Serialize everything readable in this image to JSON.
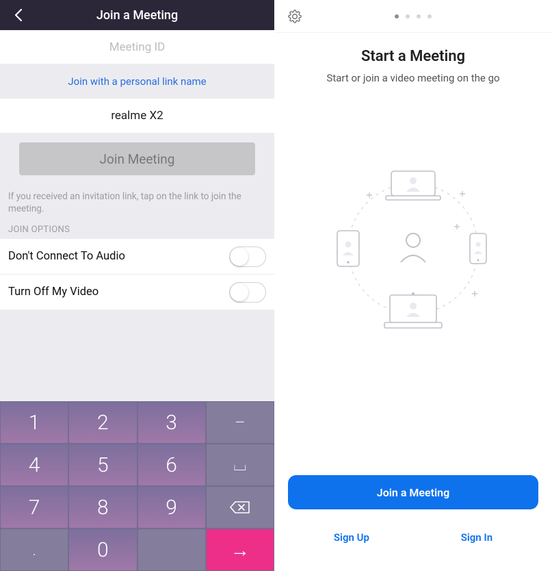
{
  "left": {
    "title": "Join a Meeting",
    "meeting_id_placeholder": "Meeting ID",
    "personal_link_text": "Join with a personal link name",
    "device_name": "realme X2",
    "join_button_label": "Join Meeting",
    "help_text": "If you received an invitation link, tap on the link to join the meeting.",
    "section_label": "JOIN OPTIONS",
    "options": [
      {
        "label": "Don't Connect To Audio",
        "on": false
      },
      {
        "label": "Turn Off My Video",
        "on": false
      }
    ],
    "keypad": {
      "rows": [
        [
          "1",
          "2",
          "3",
          "–"
        ],
        [
          "4",
          "5",
          "6",
          "⌴"
        ],
        [
          "7",
          "8",
          "9",
          "⌫"
        ],
        [
          ".",
          "0",
          "",
          "→"
        ]
      ]
    }
  },
  "right": {
    "title": "Start a Meeting",
    "subtitle": "Start or join a video meeting on the go",
    "page_count": 4,
    "active_page": 0,
    "join_label": "Join a Meeting",
    "signup_label": "Sign Up",
    "signin_label": "Sign In"
  }
}
